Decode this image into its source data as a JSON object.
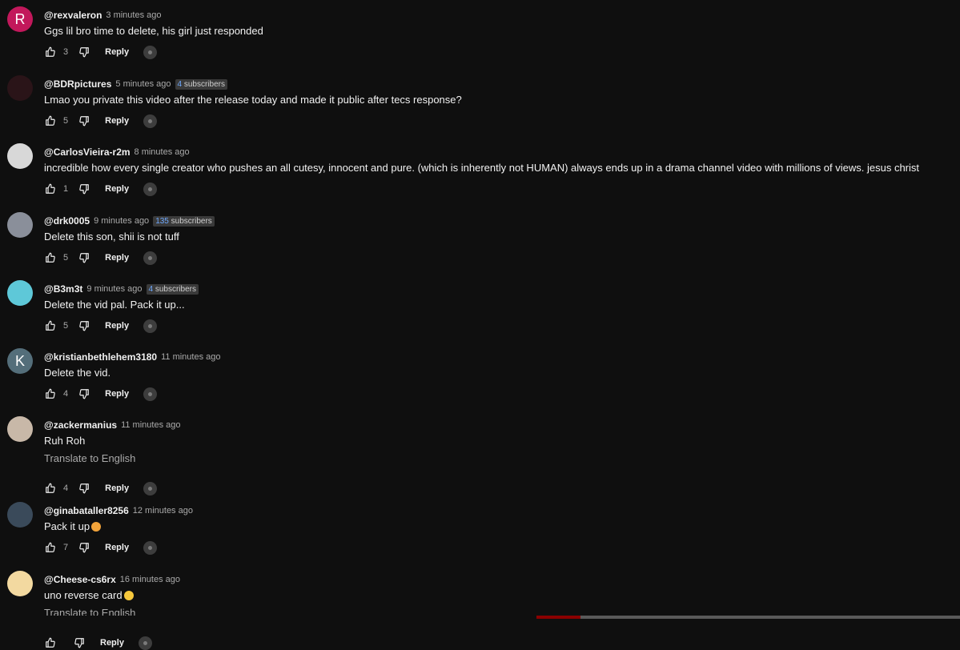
{
  "comments": [
    {
      "handle": "@rexvaleron",
      "time": "3 minutes ago",
      "subscribers": null,
      "text": "Ggs lil bro time to delete, his girl just responded",
      "translate": null,
      "likes": "3",
      "avatar_letter": "R",
      "avatar_color": "#c2185b",
      "emoji": null
    },
    {
      "handle": "@BDRpictures",
      "time": "5 minutes ago",
      "subscribers": {
        "number": "4",
        "label": "subscribers"
      },
      "text": "Lmao you private this video after the release today and made it public after tecs response?",
      "translate": null,
      "likes": "5",
      "avatar_letter": "",
      "avatar_color": "#2a1418",
      "emoji": null
    },
    {
      "handle": "@CarlosVieira-r2m",
      "time": "8 minutes ago",
      "subscribers": null,
      "text": "incredible how every single creator who pushes an all cutesy,  innocent and pure. (which is inherently not HUMAN) always ends up in a drama channel video with millions of views. jesus christ",
      "translate": null,
      "likes": "1",
      "avatar_letter": "",
      "avatar_color": "#d8d8d8",
      "emoji": null
    },
    {
      "handle": "@drk0005",
      "time": "9 minutes ago",
      "subscribers": {
        "number": "135",
        "label": "subscribers"
      },
      "text": "Delete this son, shii is not tuff",
      "translate": null,
      "likes": "5",
      "avatar_letter": "",
      "avatar_color": "#8a8f9a",
      "emoji": null
    },
    {
      "handle": "@B3m3t",
      "time": "9 minutes ago",
      "subscribers": {
        "number": "4",
        "label": "subscribers"
      },
      "text": "Delete the vid pal. Pack it up...",
      "translate": null,
      "likes": "5",
      "avatar_letter": "",
      "avatar_color": "#5ec8d8",
      "emoji": null
    },
    {
      "handle": "@kristianbethlehem3180",
      "time": "11 minutes ago",
      "subscribers": null,
      "text": "Delete the vid.",
      "translate": null,
      "likes": "4",
      "avatar_letter": "K",
      "avatar_color": "#546e7a",
      "emoji": null
    },
    {
      "handle": "@zackermanius",
      "time": "11 minutes ago",
      "subscribers": null,
      "text": "Ruh Roh",
      "translate": "Translate to English",
      "likes": "4",
      "avatar_letter": "",
      "avatar_color": "#c8b8a8",
      "emoji": null
    },
    {
      "handle": "@ginabataller8256",
      "time": "12 minutes ago",
      "subscribers": null,
      "text": "Pack it up",
      "translate": null,
      "likes": "7",
      "avatar_letter": "",
      "avatar_color": "#3a4a5a",
      "emoji": "wink"
    },
    {
      "handle": "@Cheese-cs6rx",
      "time": "16 minutes ago",
      "subscribers": null,
      "text": "uno reverse card",
      "translate": "Translate to English",
      "likes": "",
      "avatar_letter": "",
      "avatar_color": "#f3d9a0",
      "emoji": "laugh"
    }
  ],
  "actions": {
    "reply_label": "Reply"
  }
}
